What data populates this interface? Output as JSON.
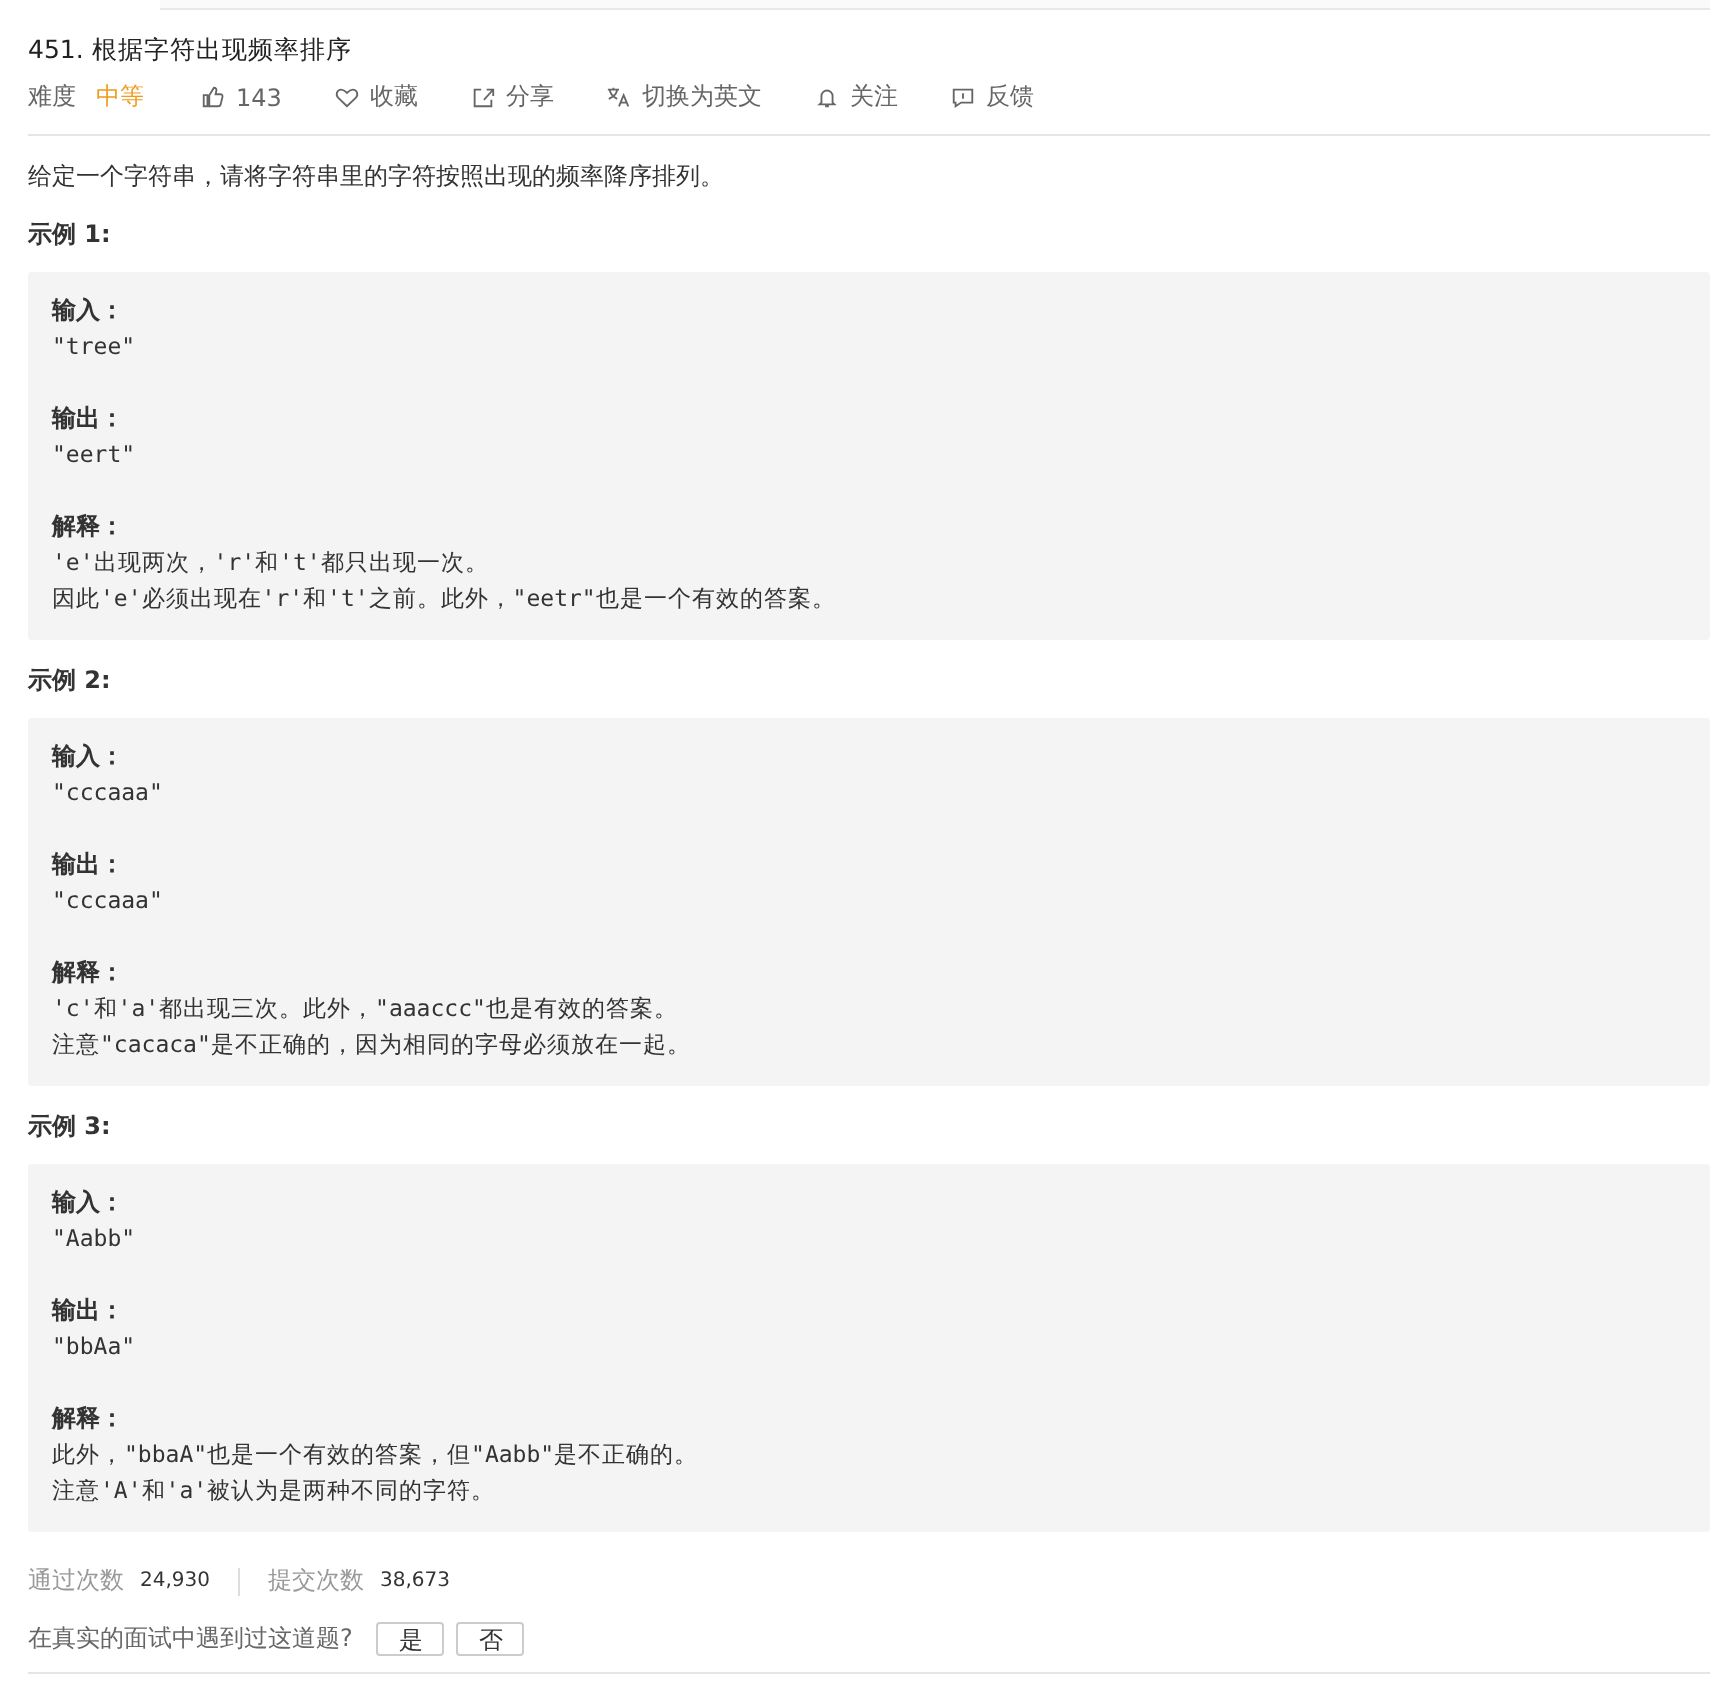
{
  "problem": {
    "title": "451. 根据字符出现频率排序",
    "difficulty_label": "难度",
    "difficulty": "中等",
    "actions": [
      {
        "kind": "like",
        "label": "143"
      },
      {
        "kind": "favorite",
        "label": "收藏"
      },
      {
        "kind": "share",
        "label": "分享"
      },
      {
        "kind": "translate",
        "label": "切换为英文"
      },
      {
        "kind": "follow",
        "label": "关注"
      },
      {
        "kind": "feedback",
        "label": "反馈"
      }
    ],
    "description": "给定一个字符串，请将字符串里的字符按照出现的频率降序排列。",
    "examples": [
      {
        "heading": "示例 1:",
        "sections": [
          {
            "label": "输入：",
            "lines": [
              "\"tree\""
            ]
          },
          {
            "label": "输出：",
            "lines": [
              "\"eert\""
            ]
          },
          {
            "label": "解释：",
            "lines": [
              "'e'出现两次，'r'和't'都只出现一次。",
              "因此'e'必须出现在'r'和't'之前。此外，\"eetr\"也是一个有效的答案。"
            ]
          }
        ]
      },
      {
        "heading": "示例 2:",
        "sections": [
          {
            "label": "输入：",
            "lines": [
              "\"cccaaa\""
            ]
          },
          {
            "label": "输出：",
            "lines": [
              "\"cccaaa\""
            ]
          },
          {
            "label": "解释：",
            "lines": [
              "'c'和'a'都出现三次。此外，\"aaaccc\"也是有效的答案。",
              "注意\"cacaca\"是不正确的，因为相同的字母必须放在一起。"
            ]
          }
        ]
      },
      {
        "heading": "示例 3:",
        "sections": [
          {
            "label": "输入：",
            "lines": [
              "\"Aabb\""
            ]
          },
          {
            "label": "输出：",
            "lines": [
              "\"bbAa\""
            ]
          },
          {
            "label": "解释：",
            "lines": [
              "此外，\"bbaA\"也是一个有效的答案，但\"Aabb\"是不正确的。",
              "注意'A'和'a'被认为是两种不同的字符。"
            ]
          }
        ]
      }
    ],
    "stats": [
      {
        "label": "通过次数",
        "value": "24,930"
      },
      {
        "label": "提交次数",
        "value": "38,673"
      }
    ],
    "interview": {
      "question": "在真实的面试中遇到过这道题?",
      "buttons": [
        "是",
        "否"
      ]
    }
  }
}
